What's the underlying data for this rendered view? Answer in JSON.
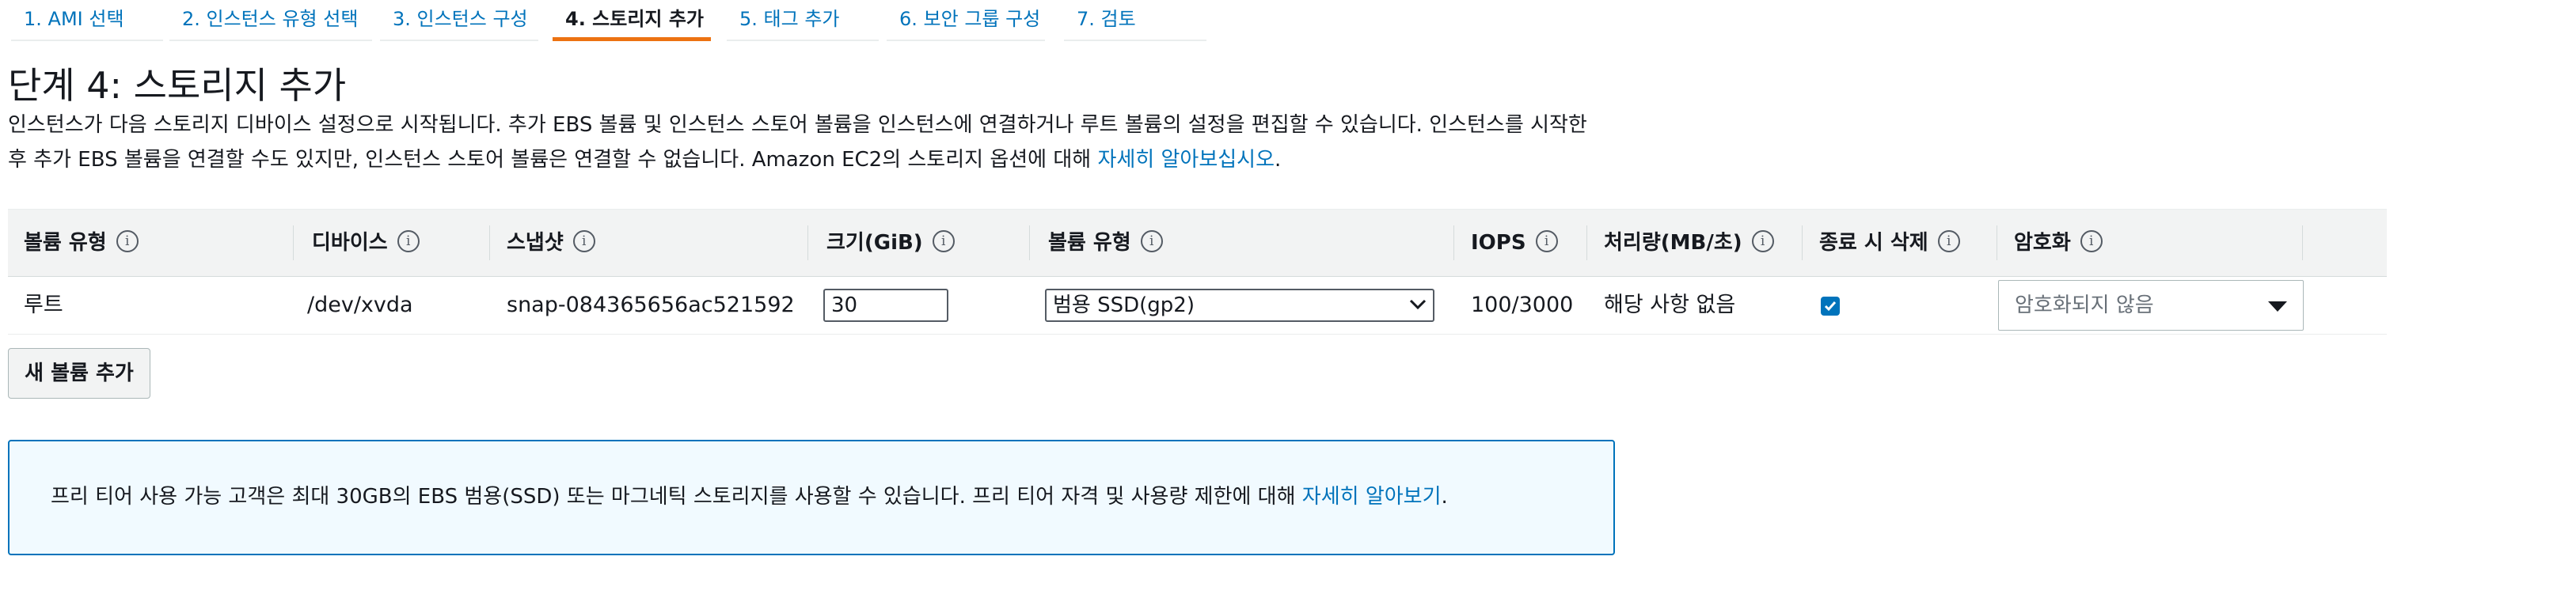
{
  "wizard": {
    "tabs": [
      {
        "label": "1. AMI 선택",
        "active": false
      },
      {
        "label": "2. 인스턴스 유형 선택",
        "active": false
      },
      {
        "label": "3. 인스턴스 구성",
        "active": false
      },
      {
        "label": "4. 스토리지 추가",
        "active": true
      },
      {
        "label": "5. 태그 추가",
        "active": false
      },
      {
        "label": "6. 보안 그룹 구성",
        "active": false
      },
      {
        "label": "7. 검토",
        "active": false
      }
    ]
  },
  "page": {
    "title": "단계 4: 스토리지 추가",
    "intro_line1": "인스턴스가 다음 스토리지 디바이스 설정으로 시작됩니다. 추가 EBS 볼륨 및 인스턴스 스토어 볼륨을 인스턴스에 연결하거나 루트 볼륨의 설정을 편집할 수 있습니다. 인스턴스를 시작한",
    "intro_line2": "후 추가 EBS 볼륨을 연결할 수도 있지만, 인스턴스 스토어 볼륨은 연결할 수 없습니다. Amazon EC2의 스토리지 옵션에 대해 ",
    "intro_link": "자세히 알아보십시오",
    "intro_end": "."
  },
  "table": {
    "headers": {
      "volume_type": "볼륨 유형",
      "device": "디바이스",
      "snapshot": "스냅샷",
      "size": "크기(GiB)",
      "ebs_type": "볼륨 유형",
      "iops": "IOPS",
      "throughput": "처리량(MB/초)",
      "delete_on_termination": "종료 시 삭제",
      "encryption": "암호화"
    },
    "info_glyph": "i",
    "rows": [
      {
        "volume_type": "루트",
        "device": "/dev/xvda",
        "snapshot": "snap-084365656ac521592",
        "size": "30",
        "ebs_type": "범용 SSD(gp2)",
        "iops": "100/3000",
        "throughput": "해당 사항 없음",
        "delete_on_termination": true,
        "encryption": "암호화되지 않음"
      }
    ]
  },
  "add_volume_button": "새 볼륨 추가",
  "notice": {
    "text": "프리 티어 사용 가능 고객은 최대 30GB의 EBS 범용(SSD) 또는 마그네틱 스토리지를 사용할 수 있습니다. 프리 티어 자격 및 사용량 제한에 대해 ",
    "link": "자세히 알아보기",
    "end": "."
  },
  "colors": {
    "accent_orange": "#ec7211",
    "link_blue": "#0073bb",
    "header_gray": "#f2f3f3",
    "notice_bg": "#f1faff"
  },
  "icons": {
    "info": "info-icon",
    "dropdown": "chevron-down-icon",
    "caret": "caret-down-icon",
    "check": "checkmark-icon"
  }
}
